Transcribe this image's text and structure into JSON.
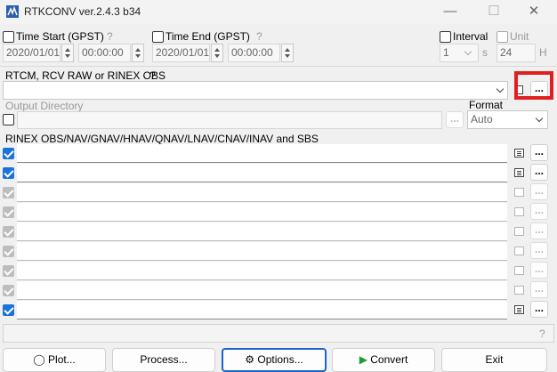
{
  "window": {
    "title": "RTKCONV ver.2.4.3 b34",
    "controls": {
      "minimize": "—",
      "maximize": "☐",
      "close": "✕"
    }
  },
  "time_start": {
    "label": "Time Start (GPST)",
    "help": "?",
    "date": "2020/01/01",
    "time": "00:00:00"
  },
  "time_end": {
    "label": "Time End (GPST)",
    "help": "?",
    "date": "2020/01/01",
    "time": "00:00:00"
  },
  "interval": {
    "label": "Interval",
    "value": "1",
    "unit": "s"
  },
  "unit": {
    "label": "Unit",
    "value": "24",
    "unit": "H"
  },
  "input": {
    "label": "RTCM, RCV RAW or RINEX OBS",
    "help": "?",
    "browse": "..."
  },
  "output_dir": {
    "label": "Output Directory",
    "browse": "..."
  },
  "format": {
    "label": "Format",
    "selected": "Auto"
  },
  "rinex": {
    "label": "RINEX OBS/NAV/GNAV/HNAV/QNAV/LNAV/CNAV/INAV and SBS"
  },
  "file_rows": [
    {
      "browse": "..."
    },
    {
      "browse": "..."
    },
    {
      "browse": "..."
    },
    {
      "browse": "..."
    },
    {
      "browse": "..."
    },
    {
      "browse": "..."
    },
    {
      "browse": "..."
    },
    {
      "browse": "..."
    },
    {
      "browse": "..."
    }
  ],
  "status": {
    "help": "?"
  },
  "buttons": {
    "plot": "Plot...",
    "process": "Process...",
    "options": "Options...",
    "convert": "Convert",
    "exit": "Exit"
  },
  "colors": {
    "accent": "#1a73d9",
    "highlight": "#e0201f",
    "convert_icon": "#1e9e2e"
  }
}
